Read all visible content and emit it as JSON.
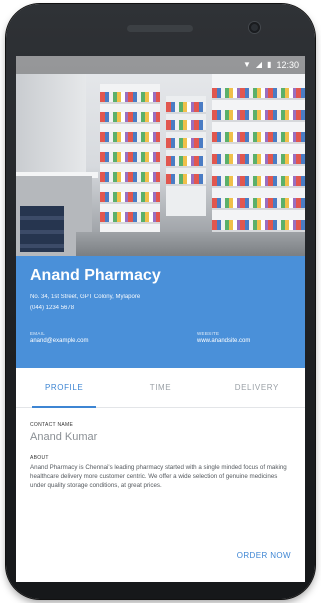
{
  "status_bar": {
    "time": "12:30",
    "icons": [
      "wifi-icon",
      "signal-icon",
      "battery-icon"
    ]
  },
  "pharmacy": {
    "name": "Anand Pharmacy",
    "address": "No. 34, 1st Street, GPT Colony, Mylapore",
    "phone": "(044) 1234 5678",
    "email_label": "EMAIL",
    "email": "anand@example.com",
    "website_label": "WEBSITE",
    "website": "www.anandsite.com"
  },
  "tabs": [
    {
      "label": "PROFILE",
      "active": true
    },
    {
      "label": "TIME",
      "active": false
    },
    {
      "label": "DELIVERY",
      "active": false
    }
  ],
  "profile": {
    "contact_label": "CONTACT NAME",
    "contact_name": "Anand Kumar",
    "about_label": "ABOUT",
    "about_text": "Anand Pharmacy is Chennai's leading pharmacy started with a single minded focus of making healthcare delivery more customer centric. We offer a wide selection of genuine medicines under quality storage conditions, at great prices."
  },
  "actions": {
    "order_label": "ORDER NOW"
  },
  "colors": {
    "accent": "#4a90d9",
    "tab_active": "#3d85d3",
    "tab_inactive": "#9aa0a6"
  }
}
